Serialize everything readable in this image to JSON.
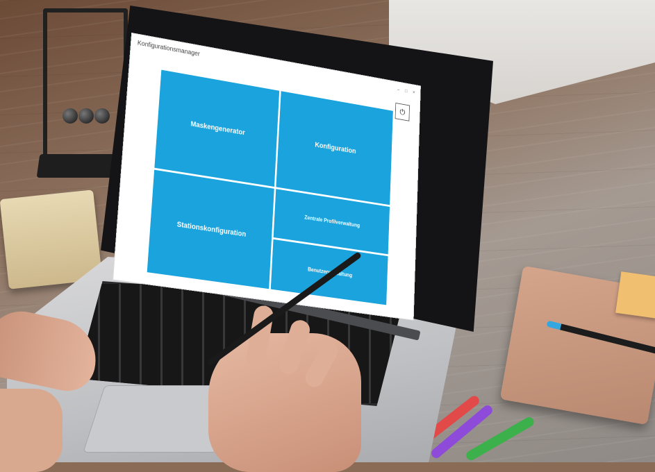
{
  "window": {
    "title": "Konfigurationsmanager",
    "controls": {
      "minimize": "–",
      "maximize": "□",
      "close": "×"
    }
  },
  "power_button": {
    "icon": "power-icon",
    "glyph": "⏻"
  },
  "tiles": [
    {
      "id": "maskengenerator",
      "label": "Maskengenerator"
    },
    {
      "id": "konfiguration",
      "label": "Konfiguration"
    },
    {
      "id": "stationskonfiguration",
      "label": "Stationskonfiguration"
    },
    {
      "id": "zentrale-profilverwaltung",
      "label": "Zentrale Profilverwaltung"
    },
    {
      "id": "benutzerverwaltung",
      "label": "Benutzerverwaltung"
    }
  ],
  "colors": {
    "tile": "#1aa3dc",
    "tile_text": "#ffffff",
    "window_bg": "#ffffff"
  }
}
